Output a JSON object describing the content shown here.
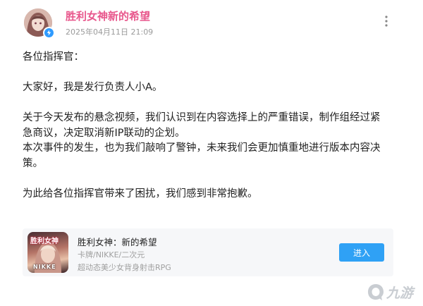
{
  "post": {
    "author_name": "胜利女神新的希望",
    "timestamp": "2025年04月11日 21:09",
    "paragraphs": [
      "各位指挥官：",
      "大家好，我是发行负责人小A。",
      "关于今天发布的悬念视频，我们认识到在内容选择上的严重错误，制作组经过紧\n急商议，决定取消新IP联动的企划。\n本次事件的发生，也为我们敲响了警钟，未来我们会更加慎重地进行版本内容决\n策。",
      "为此给各位指挥官带来了困扰，我们感到非常抱歉。"
    ]
  },
  "game_card": {
    "title": "胜利女神：新的希望",
    "tags": "卡牌/NIKKE/二次元",
    "description": "超动态美少女背身射击RPG",
    "button_label": "进入",
    "icon_logo_text": "胜利女神",
    "icon_logo_subtext": "NIKKE"
  },
  "watermark": {
    "text": "九游"
  },
  "colors": {
    "author": "#e8578c",
    "button": "#2fa1f5",
    "verified": "#2f9bff",
    "card_bg": "#f6f7f9"
  }
}
